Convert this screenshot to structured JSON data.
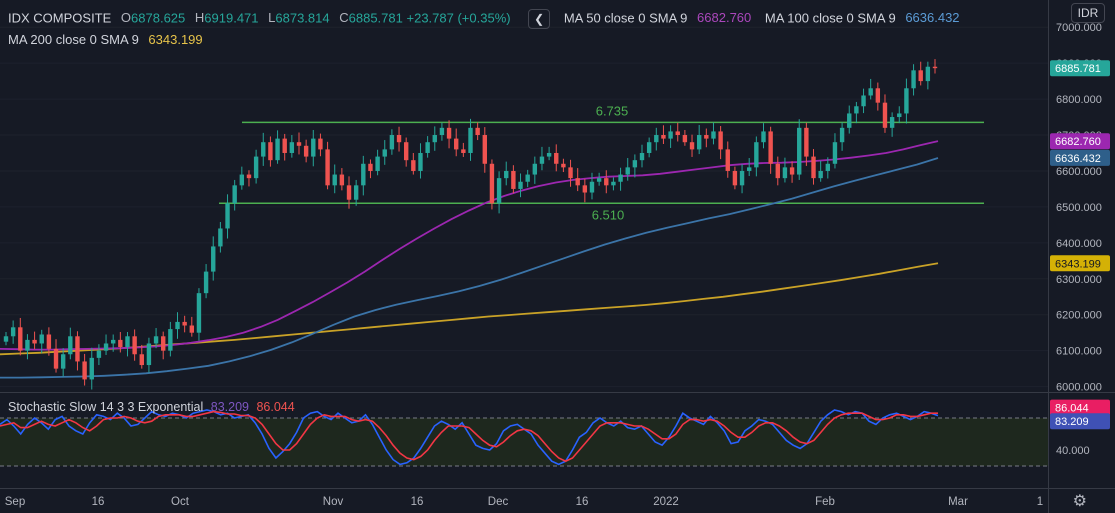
{
  "header": {
    "symbol": "IDX COMPOSITE",
    "o_key": "O",
    "open": "6878.625",
    "h_key": "H",
    "high": "6919.471",
    "l_key": "L",
    "low": "6873.814",
    "c_key": "C",
    "close": "6885.781",
    "change": "+23.787 (+0.35%)",
    "collapse_icon": "chevron-left-icon",
    "currency": "IDR"
  },
  "indicators": {
    "ma50": {
      "label": "MA 50 close 0 SMA 9",
      "value": "6682.760",
      "color": "#9c27b0"
    },
    "ma100": {
      "label": "MA 100 close 0 SMA 9",
      "value": "6636.432",
      "color": "#3b74a8"
    },
    "ma200": {
      "label": "MA 200 close 0 SMA 9",
      "value": "6343.199",
      "color": "#c9a227"
    }
  },
  "stochastic": {
    "label": "Stochastic Slow 14 3 3 Exponential",
    "k_value": "83.209",
    "k_color": "#2962ff",
    "d_value": "86.044",
    "d_color": "#f23645",
    "axis_label": "40.000",
    "upper_band": 80,
    "lower_band": 20
  },
  "settings_icon": "gear-icon",
  "chart_data": {
    "type": "candlestick",
    "price_axis": {
      "ticks": [
        "7000.000",
        "6900.000",
        "6800.000",
        "6700.000",
        "6600.000",
        "6500.000",
        "6400.000",
        "6300.000",
        "6200.000",
        "6100.000",
        "6000.000"
      ],
      "range": [
        5985,
        7020
      ]
    },
    "time_axis": {
      "labels": [
        "Sep",
        "16",
        "Oct",
        "Nov",
        "16",
        "Dec",
        "16",
        "2022",
        "Feb",
        "Mar",
        "1"
      ]
    },
    "last_price": "6885.781",
    "levels": [
      {
        "value": 6735,
        "label": "6.735"
      },
      {
        "value": 6510,
        "label": "6.510"
      }
    ],
    "closes": [
      6140,
      6165,
      6100,
      6130,
      6120,
      6145,
      6105,
      6050,
      6090,
      6140,
      6070,
      6020,
      6080,
      6100,
      6120,
      6130,
      6110,
      6140,
      6090,
      6060,
      6120,
      6140,
      6100,
      6160,
      6180,
      6170,
      6150,
      6260,
      6320,
      6390,
      6440,
      6510,
      6560,
      6590,
      6580,
      6640,
      6680,
      6630,
      6690,
      6650,
      6680,
      6670,
      6640,
      6690,
      6660,
      6560,
      6590,
      6560,
      6520,
      6560,
      6620,
      6600,
      6640,
      6660,
      6700,
      6680,
      6630,
      6600,
      6650,
      6680,
      6700,
      6720,
      6690,
      6660,
      6650,
      6720,
      6700,
      6620,
      6510,
      6580,
      6600,
      6550,
      6570,
      6590,
      6620,
      6640,
      6650,
      6620,
      6610,
      6580,
      6560,
      6540,
      6570,
      6580,
      6560,
      6570,
      6590,
      6610,
      6630,
      6650,
      6680,
      6700,
      6690,
      6710,
      6700,
      6680,
      6660,
      6700,
      6690,
      6710,
      6660,
      6600,
      6560,
      6600,
      6610,
      6680,
      6710,
      6620,
      6580,
      6610,
      6590,
      6720,
      6640,
      6580,
      6600,
      6620,
      6680,
      6720,
      6760,
      6780,
      6810,
      6830,
      6790,
      6720,
      6750,
      6760,
      6830,
      6880,
      6850,
      6890,
      6886
    ],
    "ma50": [
      6105,
      6104,
      6103,
      6103,
      6104,
      6105,
      6106,
      6107,
      6109,
      6112,
      6116,
      6122,
      6129,
      6138,
      6150,
      6166,
      6186,
      6210,
      6235,
      6262,
      6290,
      6320,
      6352,
      6383,
      6412,
      6440,
      6466,
      6490,
      6512,
      6530,
      6545,
      6558,
      6568,
      6575,
      6580,
      6584,
      6586,
      6588,
      6592,
      6598,
      6604,
      6610,
      6616,
      6620,
      6622,
      6623,
      6625,
      6628,
      6632,
      6637,
      6643,
      6650,
      6660,
      6672,
      6683
    ],
    "ma100": [
      6025,
      6025,
      6026,
      6027,
      6028,
      6030,
      6033,
      6037,
      6043,
      6050,
      6058,
      6070,
      6085,
      6102,
      6123,
      6147,
      6172,
      6195,
      6213,
      6228,
      6240,
      6252,
      6265,
      6280,
      6297,
      6316,
      6336,
      6356,
      6376,
      6395,
      6412,
      6428,
      6442,
      6455,
      6468,
      6480,
      6494,
      6508,
      6523,
      6540,
      6557,
      6573,
      6588,
      6603,
      6618,
      6636
    ],
    "ma200": [
      6090,
      6092,
      6094,
      6097,
      6100,
      6103,
      6106,
      6110,
      6114,
      6118,
      6122,
      6126,
      6130,
      6135,
      6140,
      6145,
      6150,
      6155,
      6160,
      6165,
      6170,
      6175,
      6180,
      6185,
      6190,
      6195,
      6199,
      6203,
      6207,
      6211,
      6215,
      6219,
      6223,
      6227,
      6232,
      6238,
      6244,
      6250,
      6257,
      6264,
      6272,
      6280,
      6288,
      6296,
      6305,
      6314,
      6324,
      6334,
      6343
    ],
    "stoch_k": [
      72,
      78,
      70,
      60,
      72,
      80,
      74,
      66,
      78,
      82,
      70,
      64,
      60,
      74,
      84,
      82,
      78,
      86,
      80,
      70,
      72,
      80,
      88,
      84,
      82,
      86,
      84,
      80,
      86,
      88,
      90,
      88,
      84,
      86,
      80,
      82,
      84,
      74,
      60,
      42,
      30,
      38,
      48,
      62,
      80,
      86,
      88,
      82,
      78,
      86,
      80,
      74,
      76,
      84,
      72,
      56,
      40,
      28,
      22,
      24,
      30,
      42,
      56,
      70,
      76,
      72,
      66,
      74,
      60,
      46,
      42,
      40,
      48,
      64,
      70,
      72,
      66,
      60,
      46,
      36,
      26,
      22,
      26,
      40,
      56,
      62,
      74,
      80,
      74,
      70,
      76,
      68,
      66,
      70,
      60,
      50,
      46,
      56,
      70,
      86,
      80,
      76,
      72,
      82,
      74,
      64,
      48,
      50,
      64,
      70,
      78,
      76,
      72,
      62,
      52,
      46,
      42,
      48,
      62,
      76,
      84,
      90,
      88,
      84,
      88,
      86,
      76,
      72,
      80,
      84,
      86,
      82,
      78,
      82,
      88,
      86,
      83
    ],
    "stoch_d": [
      70,
      72,
      74,
      68,
      68,
      72,
      76,
      72,
      70,
      74,
      78,
      74,
      68,
      64,
      70,
      78,
      80,
      80,
      82,
      80,
      76,
      74,
      76,
      82,
      84,
      84,
      84,
      82,
      82,
      84,
      86,
      88,
      87,
      85,
      85,
      83,
      83,
      80,
      72,
      60,
      48,
      40,
      40,
      48,
      60,
      72,
      80,
      84,
      82,
      82,
      82,
      78,
      76,
      78,
      76,
      68,
      58,
      46,
      36,
      30,
      28,
      32,
      40,
      52,
      62,
      70,
      70,
      70,
      68,
      60,
      52,
      46,
      44,
      50,
      58,
      64,
      66,
      64,
      58,
      48,
      38,
      30,
      26,
      30,
      40,
      50,
      60,
      70,
      74,
      74,
      74,
      72,
      70,
      70,
      66,
      60,
      54,
      54,
      60,
      72,
      78,
      78,
      76,
      78,
      76,
      70,
      62,
      56,
      56,
      62,
      70,
      74,
      74,
      70,
      64,
      56,
      50,
      48,
      52,
      62,
      72,
      80,
      84,
      86,
      86,
      86,
      82,
      78,
      78,
      80,
      84,
      84,
      82,
      82,
      84,
      86,
      86
    ]
  }
}
